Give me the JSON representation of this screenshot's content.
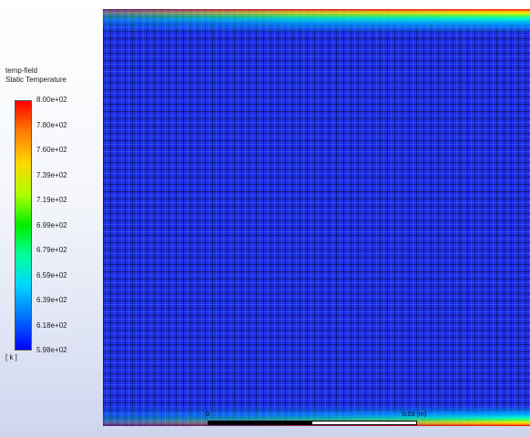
{
  "legend": {
    "name": "temp-field",
    "variable": "Static Temperature",
    "unit": "[ k ]",
    "ticks": [
      "8.00e+02",
      "7.80e+02",
      "7.60e+02",
      "7.39e+02",
      "7.19e+02",
      "6.99e+02",
      "6.79e+02",
      "6.59e+02",
      "6.39e+02",
      "6.18e+02",
      "5.98e+02"
    ],
    "colormap": [
      "#ff0000",
      "#ff7a00",
      "#ffd700",
      "#aaff00",
      "#00ee00",
      "#00ff99",
      "#00d8ff",
      "#0070ff",
      "#0000ff"
    ]
  },
  "field": {
    "base_color": "#1a2ee8",
    "hot_edge_color": "#ff0000"
  },
  "scale": {
    "zero_label": "0",
    "value_label": "0.03 (m)"
  }
}
